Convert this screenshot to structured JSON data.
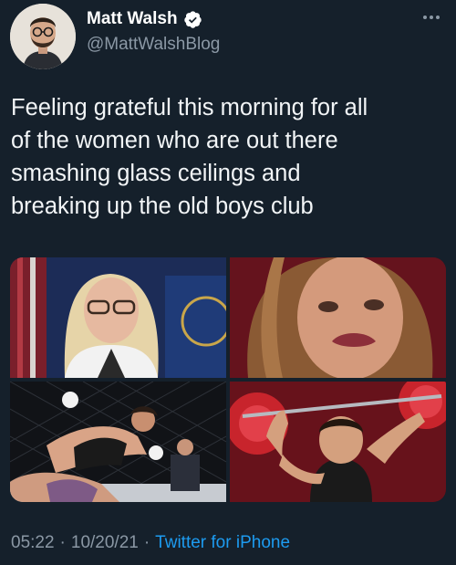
{
  "author": {
    "display_name": "Matt Walsh",
    "handle": "@MattWalshBlog",
    "verified": true,
    "verified_color": "#1d9bf0"
  },
  "tweet": {
    "text": "Feeling grateful this morning for all\nof the women who are out there\nsmashing glass ceilings and\nbreaking up the old boys club",
    "time": "05:22",
    "separator_1": "·",
    "date": "10/20/21",
    "separator_2": "·",
    "source": "Twitter for iPhone"
  },
  "media": {
    "photos": [
      {
        "name": "photo-official-podium"
      },
      {
        "name": "photo-closeup-face"
      },
      {
        "name": "photo-mma-fight"
      },
      {
        "name": "photo-weightlifter"
      }
    ]
  },
  "colors": {
    "background": "#15202b",
    "text_primary": "#ffffff",
    "text_secondary": "#8b98a5",
    "link": "#1d9bf0"
  },
  "icons": {
    "verified": "verified-badge-icon",
    "more": "more-options-icon"
  }
}
